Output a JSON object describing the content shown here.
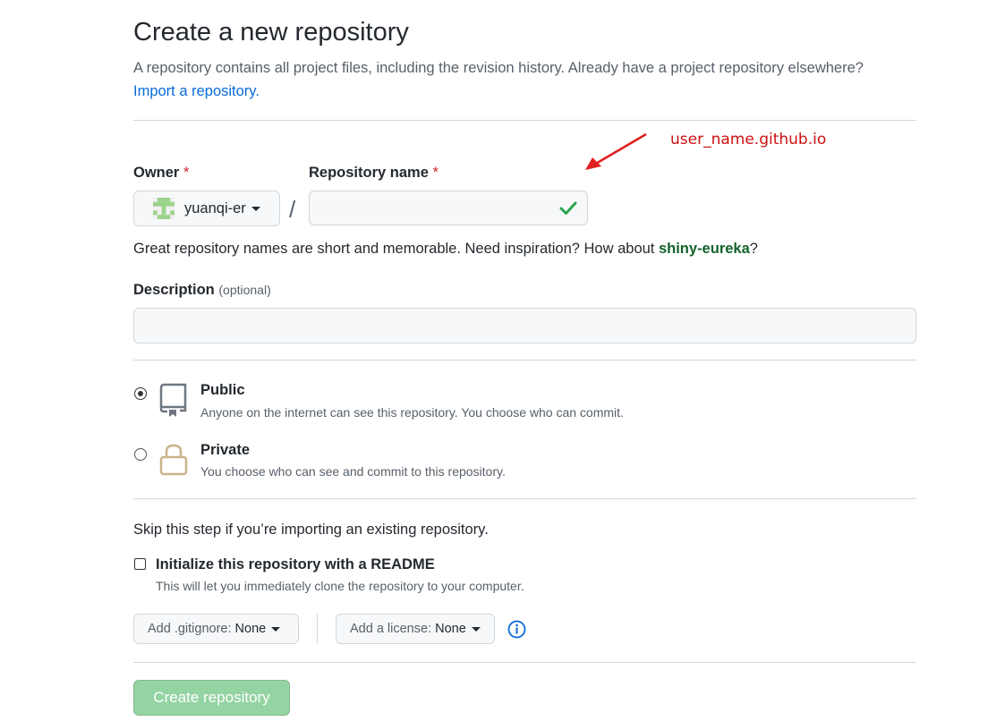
{
  "header": {
    "title": "Create a new repository",
    "subtitle": "A repository contains all project files, including the revision history. Already have a project repository elsewhere?",
    "import_link": "Import a repository."
  },
  "owner": {
    "label": "Owner",
    "required_mark": "*",
    "name": "yuanqi-er",
    "avatar_icon": "identicon-avatar"
  },
  "repo": {
    "label": "Repository name",
    "required_mark": "*",
    "value": "",
    "separator": "/",
    "valid_icon": "checkmark-icon"
  },
  "hint": {
    "text": "Great repository names are short and memorable. Need inspiration? How about ",
    "suggestion": "shiny-eureka",
    "suffix": "?"
  },
  "description": {
    "label": "Description",
    "optional": "(optional)",
    "value": ""
  },
  "visibility": {
    "public": {
      "title": "Public",
      "desc": "Anyone on the internet can see this repository. You choose who can commit.",
      "selected": true,
      "icon": "repo-book-icon"
    },
    "private": {
      "title": "Private",
      "desc": "You choose who can see and commit to this repository.",
      "selected": false,
      "icon": "lock-icon"
    }
  },
  "init": {
    "skip_text": "Skip this step if you’re importing an existing repository.",
    "readme_label": "Initialize this repository with a README",
    "readme_desc": "This will let you immediately clone the repository to your computer.",
    "readme_checked": false
  },
  "selects": {
    "gitignore_prefix": "Add .gitignore:",
    "gitignore_value": "None",
    "license_prefix": "Add a license:",
    "license_value": "None",
    "info_icon": "info-icon"
  },
  "actions": {
    "create_label": "Create repository"
  },
  "annotation": {
    "text": "user_name.github.io",
    "color": "#cc1111"
  },
  "colors": {
    "link": "#0969da",
    "required": "#cf222e",
    "suggestion": "#116329",
    "create_button_disabled": "#94d3a2",
    "check": "#2da44e"
  }
}
